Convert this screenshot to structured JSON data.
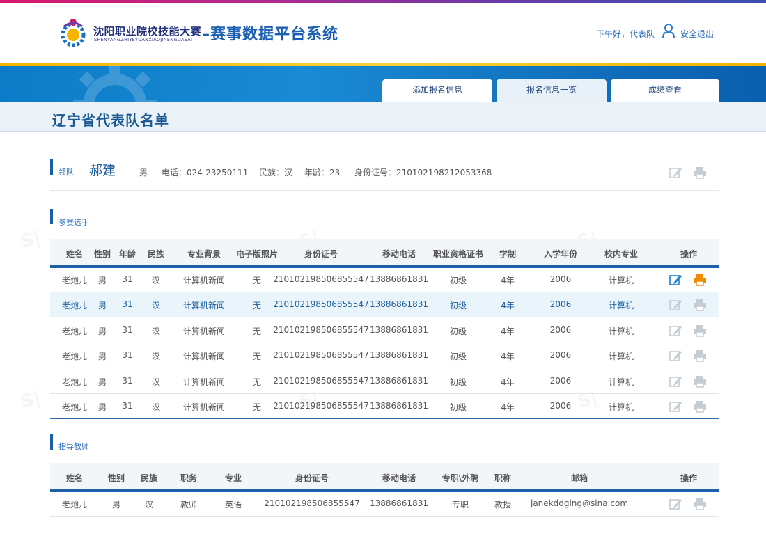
{
  "header": {
    "brand_cn": "沈阳职业院校技能大赛",
    "brand_en": "SHENYANGZHIYEYUANXIAOJINENGDASAI",
    "system_title": "–赛事数据平台系统",
    "greeting": "下午好，代表队",
    "logout": "安全退出"
  },
  "tabs": [
    {
      "label": "添加报名信息",
      "active": false
    },
    {
      "label": "报名信息一览",
      "active": true
    },
    {
      "label": "成绩查看",
      "active": false
    }
  ],
  "page_title": "辽宁省代表队名单",
  "leader": {
    "label": "领队",
    "name": "郝建",
    "gender": "男",
    "phone": "电话：024-23250111",
    "ethnicity": "民族：汉",
    "age": "年龄：23",
    "id": "身份证号：210102198212053368"
  },
  "players": {
    "section_label": "参赛选手",
    "columns": [
      "姓名",
      "性别",
      "年龄",
      "民族",
      "专业背景",
      "电子版照片",
      "身份证号",
      "移动电话",
      "职业资格证书",
      "学制",
      "入学年份",
      "校内专业",
      "操作"
    ],
    "rows": [
      [
        "老炮儿",
        "男",
        "31",
        "汉",
        "计算机新闻",
        "无",
        "210102198506855547",
        "13886861831",
        "初级",
        "4年",
        "2006",
        "计算机"
      ],
      [
        "老炮儿",
        "男",
        "31",
        "汉",
        "计算机新闻",
        "无",
        "210102198506855547",
        "13886861831",
        "初级",
        "4年",
        "2006",
        "计算机"
      ],
      [
        "老炮儿",
        "男",
        "31",
        "汉",
        "计算机新闻",
        "无",
        "210102198506855547",
        "13886861831",
        "初级",
        "4年",
        "2006",
        "计算机"
      ],
      [
        "老炮儿",
        "男",
        "31",
        "汉",
        "计算机新闻",
        "无",
        "210102198506855547",
        "13886861831",
        "初级",
        "4年",
        "2006",
        "计算机"
      ],
      [
        "老炮儿",
        "男",
        "31",
        "汉",
        "计算机新闻",
        "无",
        "210102198506855547",
        "13886861831",
        "初级",
        "4年",
        "2006",
        "计算机"
      ],
      [
        "老炮儿",
        "男",
        "31",
        "汉",
        "计算机新闻",
        "无",
        "210102198506855547",
        "13886861831",
        "初级",
        "4年",
        "2006",
        "计算机"
      ]
    ]
  },
  "teachers": {
    "section_label": "指导教师",
    "columns": [
      "姓名",
      "性别",
      "民族",
      "职务",
      "专业",
      "身份证号",
      "移动电话",
      "专职\\外聘",
      "职称",
      "邮箱",
      "操作"
    ],
    "rows": [
      [
        "老炮儿",
        "男",
        "汉",
        "教师",
        "英语",
        "210102198506855547",
        "13886861831",
        "专职",
        "教授",
        "janekddging@sina.com"
      ]
    ]
  },
  "colors": {
    "accent": "#1b5fa8",
    "brand_blue": "#1a5fb4",
    "edit_active": "#1a7fd0",
    "print_active": "#f08c00",
    "icon_muted": "#c4ccd4"
  },
  "icons": [
    "logo-icon",
    "user-icon",
    "edit-icon",
    "print-icon"
  ]
}
